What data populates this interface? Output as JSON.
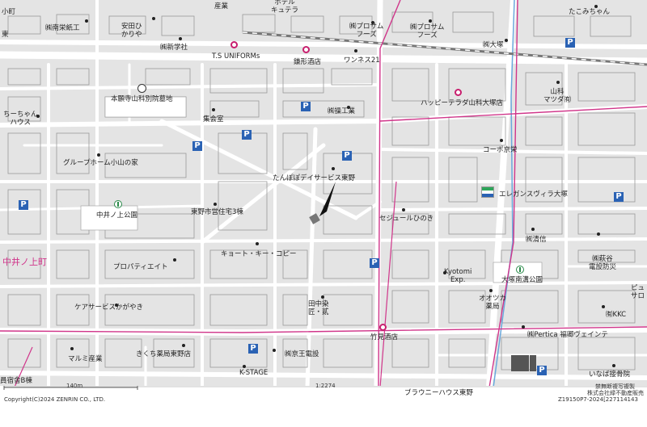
{
  "map": {
    "area_labels": [
      {
        "id": "nakainokamicho",
        "text": "中井ノ上町"
      }
    ],
    "labels": [
      {
        "id": "l1",
        "text": "ホテル\nキュテラ"
      },
      {
        "id": "l2",
        "text": "産業"
      },
      {
        "id": "l3",
        "text": "㈱南栄紙工"
      },
      {
        "id": "l4",
        "text": "安田ひ\nかりや"
      },
      {
        "id": "l5",
        "text": "㈱新学社"
      },
      {
        "id": "l6",
        "text": "T.S UNIFORMs"
      },
      {
        "id": "l7",
        "text": "鎌形酒店"
      },
      {
        "id": "l8",
        "text": "㈱プロサム\nフーズ"
      },
      {
        "id": "l9",
        "text": "㈱プロサム\nフーズ"
      },
      {
        "id": "l10",
        "text": "ワンネス21"
      },
      {
        "id": "l11",
        "text": "㈱大塚"
      },
      {
        "id": "l12",
        "text": "たこみちゃん"
      },
      {
        "id": "l13",
        "text": "本願寺山科別院墓地"
      },
      {
        "id": "l14",
        "text": "山科\nマツダ㈲"
      },
      {
        "id": "l15",
        "text": "ハッピーテラダ山科大塚店"
      },
      {
        "id": "l16",
        "text": "㈱操工業"
      },
      {
        "id": "l17",
        "text": "ちーちゃん\nハウス"
      },
      {
        "id": "l18",
        "text": "集会室"
      },
      {
        "id": "l19",
        "text": "コーポ京栄"
      },
      {
        "id": "l20",
        "text": "グループホーム小山の家"
      },
      {
        "id": "l21",
        "text": "たんぽぽデイサービス東野"
      },
      {
        "id": "l22",
        "text": "エレガンスヴィラ大塚"
      },
      {
        "id": "l23",
        "text": "中井ノ上公園"
      },
      {
        "id": "l24",
        "text": "東野市営住宅3棟"
      },
      {
        "id": "l25",
        "text": "セジュールひのき"
      },
      {
        "id": "l26",
        "text": "㈱清信"
      },
      {
        "id": "l27",
        "text": "㈱萩谷\n電設防災"
      },
      {
        "id": "l28",
        "text": "キョート・キー・コピー"
      },
      {
        "id": "l29",
        "text": "プロパティエイト"
      },
      {
        "id": "l30",
        "text": "Kyotomi\nExp."
      },
      {
        "id": "l31",
        "text": "大塚南溝公園"
      },
      {
        "id": "l32",
        "text": "オオツカ\n薬局"
      },
      {
        "id": "l33",
        "text": "ケアサービスかがやき"
      },
      {
        "id": "l34",
        "text": "田中染\n匠・貳"
      },
      {
        "id": "l35",
        "text": "竹見酒店"
      },
      {
        "id": "l36",
        "text": "㈲KKC"
      },
      {
        "id": "l37",
        "text": "㈱Pertica 福卿ヴェインテ"
      },
      {
        "id": "l38",
        "text": "マルミ産業"
      },
      {
        "id": "l39",
        "text": "きくち薬局東野店"
      },
      {
        "id": "l40",
        "text": "㈱京王電設"
      },
      {
        "id": "l41",
        "text": "いなば接骨院"
      },
      {
        "id": "l42",
        "text": "K-STAGE"
      },
      {
        "id": "l43",
        "text": "ブラウニーハウス東野"
      },
      {
        "id": "l44",
        "text": "員宿舎B棟"
      },
      {
        "id": "l45",
        "text": "ピュ\nサロ"
      },
      {
        "id": "l46",
        "text": "東"
      },
      {
        "id": "l47",
        "text": "小町"
      }
    ],
    "footer": {
      "scale_bar": "140m",
      "scale_ratio": "1:2274",
      "copyright": "Copyright(C)2024 ZENRIN CO., LTD.",
      "permission_1": "禁無断複写複製",
      "permission_2": "株式会社緑不動産販売",
      "permission_3": "Z19150P7-2024[227114143"
    },
    "colors": {
      "road": "#ffffff",
      "block": "#e4e4e4",
      "building_outline": "#9a9a9a",
      "main_road": "#d0358a",
      "river": "#6aa8dc",
      "parking": "#2a62b4",
      "shop": "#c81e6e",
      "park": "#2a8a4a",
      "area_label": "#d0358a"
    }
  }
}
